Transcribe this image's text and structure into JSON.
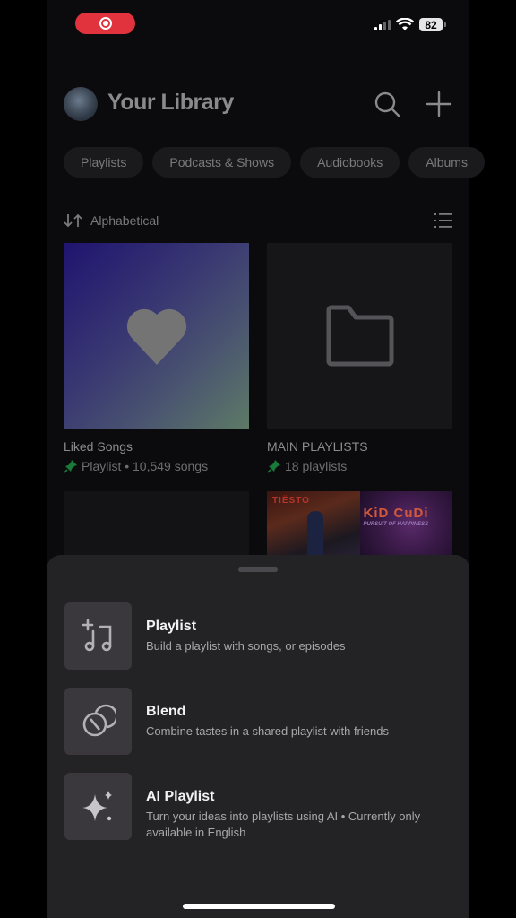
{
  "status_bar": {
    "battery": "82",
    "recording": true
  },
  "header": {
    "title": "Your Library",
    "search_icon": "search-icon",
    "add_icon": "plus-icon"
  },
  "filters": [
    {
      "label": "Playlists"
    },
    {
      "label": "Podcasts & Shows"
    },
    {
      "label": "Audiobooks"
    },
    {
      "label": "Albums"
    }
  ],
  "sort": {
    "label": "Alphabetical"
  },
  "library": [
    {
      "title": "Liked Songs",
      "subtitle": "Playlist • 10,549 songs",
      "pinned": true
    },
    {
      "title": "MAIN PLAYLISTS",
      "subtitle": "18 playlists",
      "pinned": true
    },
    {
      "title": "",
      "subtitle": ""
    },
    {
      "art_texts": [
        "TIËSTO",
        "KiD CuDi",
        "PURSUIT OF HAPPINESS"
      ]
    }
  ],
  "sheet": {
    "options": [
      {
        "title": "Playlist",
        "description": "Build a playlist with songs, or episodes"
      },
      {
        "title": "Blend",
        "description": "Combine tastes in a shared playlist with friends"
      },
      {
        "title": "AI Playlist",
        "description": "Turn your ideas into playlists using AI • Currently only available in English"
      }
    ]
  },
  "colors": {
    "accent_green": "#1db954",
    "record": "#e0333d"
  }
}
